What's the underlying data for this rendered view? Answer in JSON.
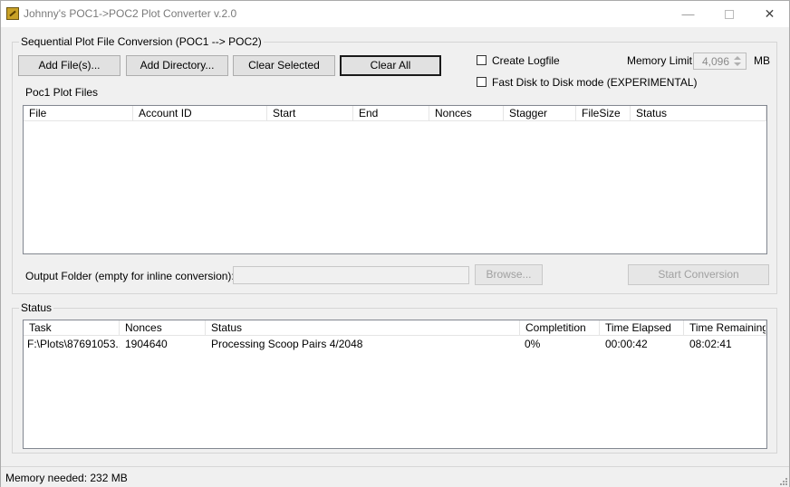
{
  "window": {
    "title": "Johnny's POC1->POC2 Plot Converter v.2.0",
    "controls": {
      "minimize": "—",
      "close": "✕"
    }
  },
  "conversion": {
    "group_title": "Sequential Plot File Conversion (POC1 --> POC2)",
    "add_files": "Add File(s)...",
    "add_directory": "Add Directory...",
    "clear_selected": "Clear Selected",
    "clear_all": "Clear All",
    "create_logfile": {
      "label": "Create Logfile",
      "checked": false
    },
    "fast_disk": {
      "label": "Fast Disk to Disk mode (EXPERIMENTAL)",
      "checked": false
    },
    "memory_limit": {
      "label": "Memory Limit",
      "value": "4,096",
      "unit": "MB"
    },
    "files_label": "Poc1 Plot Files",
    "files_columns": [
      "File",
      "Account ID",
      "Start",
      "End",
      "Nonces",
      "Stagger",
      "FileSize",
      "Status"
    ],
    "output_folder": {
      "label": "Output Folder (empty for inline conversion):",
      "value": ""
    },
    "browse": "Browse...",
    "start_conversion": "Start Conversion"
  },
  "status": {
    "group_title": "Status",
    "columns": [
      "Task",
      "Nonces",
      "Status",
      "Completition",
      "Time Elapsed",
      "Time Remaining"
    ],
    "rows": [
      {
        "task": "F:\\Plots\\87691053...",
        "nonces": "1904640",
        "status": "Processing Scoop Pairs 4/2048",
        "completion": "0%",
        "elapsed": "00:00:42",
        "remaining": "08:02:41"
      }
    ]
  },
  "statusbar": {
    "memory_needed": "Memory needed: 232 MB"
  },
  "icons": {
    "app": "app-plot-icon",
    "grip": "size-grip-icon"
  }
}
